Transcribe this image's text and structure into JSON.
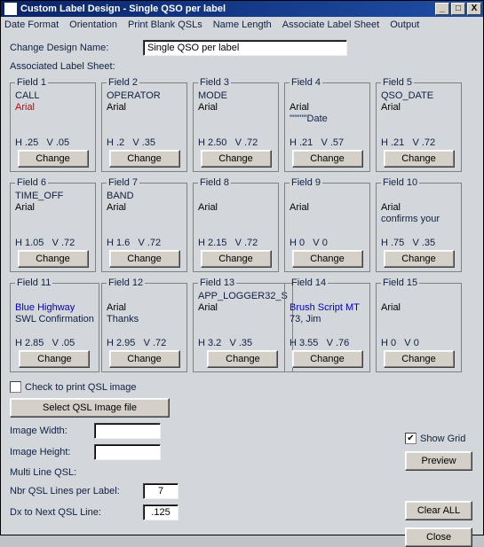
{
  "title": "Custom Label Design - Single QSO per label",
  "menu": [
    "Date Format",
    "Orientation",
    "Print Blank QSLs",
    "Name Length",
    "Associate Label Sheet",
    "Output"
  ],
  "design_name_label": "Change Design Name:",
  "design_name_value": "Single QSO per label",
  "assoc_label": "Associated Label Sheet:",
  "fields": [
    {
      "legend": "Field 1",
      "l1": "CALL",
      "l2": "Arial",
      "l2cls": "font-red",
      "l3": "",
      "h": ".25",
      "v": ".05"
    },
    {
      "legend": "Field 2",
      "l1": "OPERATOR",
      "l2": "Arial",
      "l2cls": "",
      "l3": "",
      "h": ".2",
      "v": ".35"
    },
    {
      "legend": "Field 3",
      "l1": "MODE",
      "l2": "Arial",
      "l2cls": "",
      "l3": "",
      "h": "2.50",
      "v": ".72"
    },
    {
      "legend": "Field 4",
      "l1": "",
      "l2": "Arial",
      "l2cls": "",
      "l3": "\"\"\"\"\"Date",
      "h": ".21",
      "v": ".57"
    },
    {
      "legend": "Field 5",
      "l1": "QSO_DATE",
      "l2": "Arial",
      "l2cls": "",
      "l3": "",
      "h": ".21",
      "v": ".72"
    },
    {
      "legend": "Field 6",
      "l1": "TIME_OFF",
      "l2": "Arial",
      "l2cls": "",
      "l3": "",
      "h": "1.05",
      "v": ".72"
    },
    {
      "legend": "Field 7",
      "l1": "BAND",
      "l2": "Arial",
      "l2cls": "",
      "l3": "",
      "h": "1.6",
      "v": ".72"
    },
    {
      "legend": "Field 8",
      "l1": "",
      "l2": "Arial",
      "l2cls": "",
      "l3": "",
      "h": "2.15",
      "v": ".72"
    },
    {
      "legend": "Field 9",
      "l1": "",
      "l2": "Arial",
      "l2cls": "",
      "l3": "",
      "h": "0",
      "v": "0"
    },
    {
      "legend": "Field 10",
      "l1": "",
      "l2": "Arial",
      "l2cls": "",
      "l3": "confirms your",
      "h": ".75",
      "v": ".35"
    },
    {
      "legend": "Field 11",
      "l1": "",
      "l2": "Blue Highway",
      "l2cls": "font-blue",
      "l3": "SWL Confirmation",
      "h": "2.85",
      "v": ".05"
    },
    {
      "legend": "Field 12",
      "l1": "",
      "l2": "Arial",
      "l2cls": "",
      "l3": "Thanks",
      "h": "2.95",
      "v": ".72"
    },
    {
      "legend": "Field 13",
      "l1": "APP_LOGGER32_S",
      "l2": "Arial",
      "l2cls": "",
      "l3": "",
      "h": "3.2",
      "v": ".35"
    },
    {
      "legend": "Field 14",
      "l1": "",
      "l2": "Brush Script MT",
      "l2cls": "font-blue",
      "l3": "73, Jim",
      "h": "3.55",
      "v": ".76"
    },
    {
      "legend": "Field 15",
      "l1": "",
      "l2": "Arial",
      "l2cls": "",
      "l3": "",
      "h": "0",
      "v": "0"
    }
  ],
  "change_label": "Change",
  "check_qsl_img": "Check to print QSL image",
  "select_qsl_img": "Select QSL Image file",
  "img_width_lbl": "Image Width:",
  "img_height_lbl": "Image Height:",
  "multi_line_lbl": "Multi Line QSL:",
  "nbr_lines_lbl": "Nbr QSL Lines per Label:",
  "nbr_lines_val": "7",
  "dx_lbl": "Dx to Next QSL Line:",
  "dx_val": ".125",
  "show_grid_lbl": "Show Grid",
  "preview_lbl": "Preview",
  "clear_all_lbl": "Clear ALL",
  "close_lbl": "Close"
}
